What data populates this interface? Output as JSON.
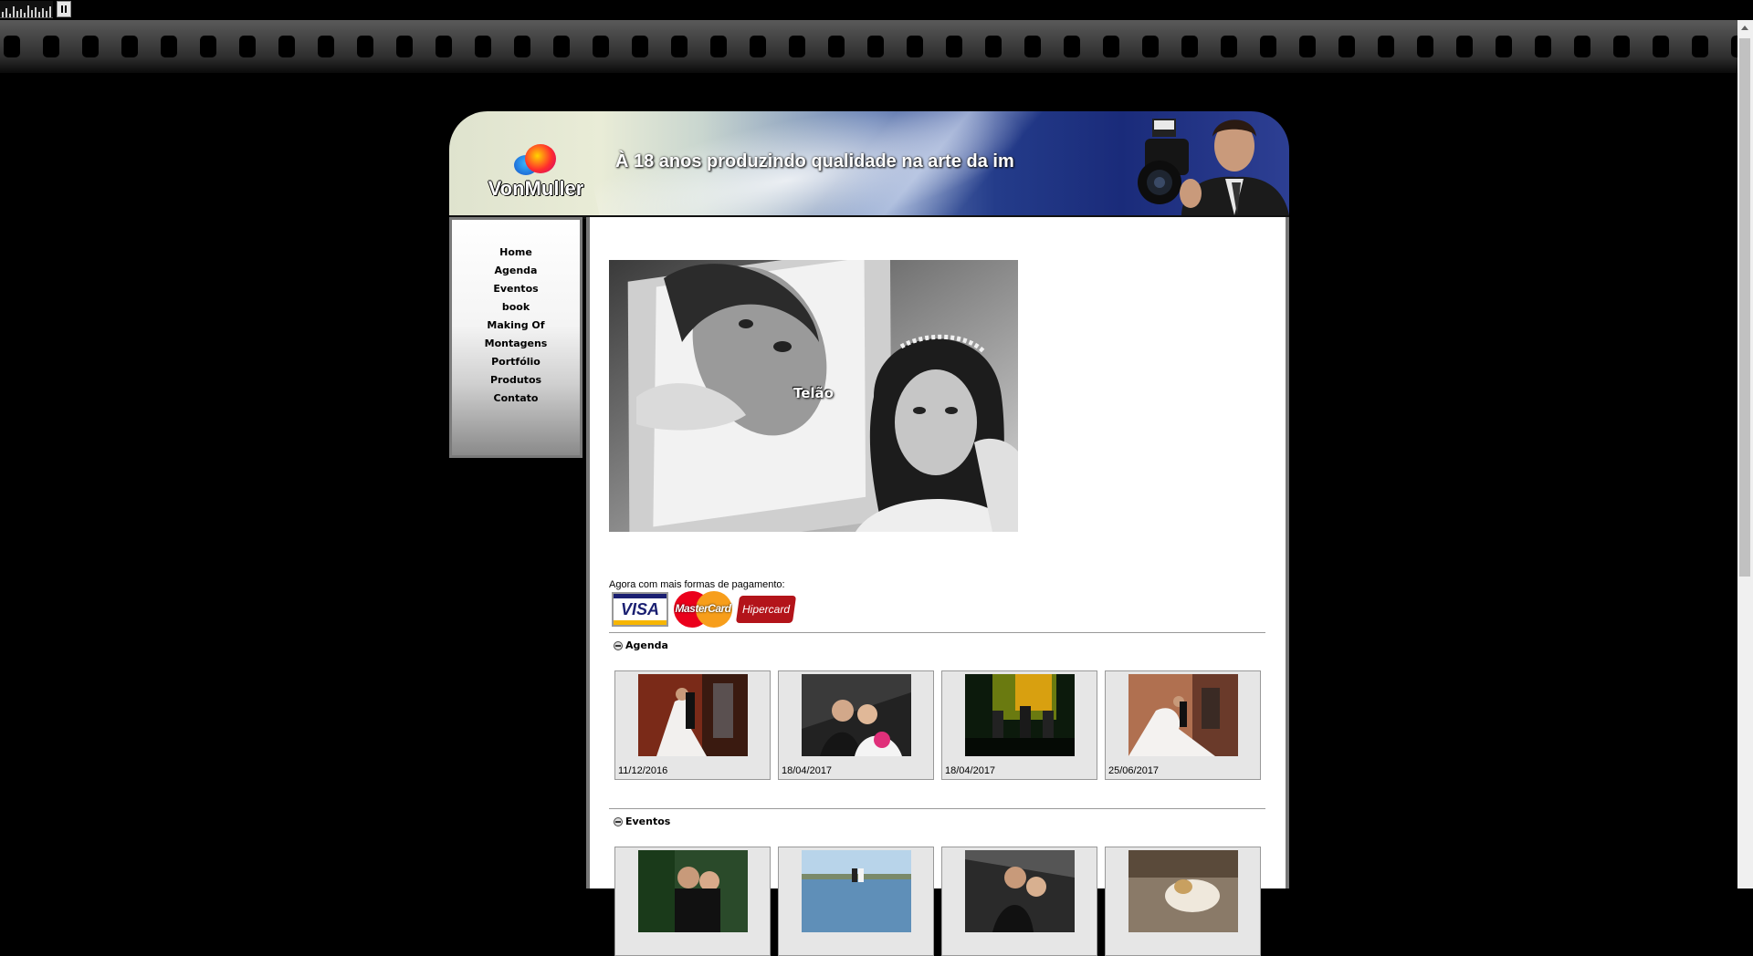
{
  "player": {
    "pause_icon": "pause-icon"
  },
  "colors": {
    "background": "#000000",
    "content_bg": "#ffffff",
    "nav_border": "#7a7a7a",
    "visa_blue": "#1a1f71",
    "hipercard_red": "#b3141a"
  },
  "header": {
    "logo_text": "VonMuller",
    "tagline": "À 18 anos produzindo qualidade na arte da im"
  },
  "nav": {
    "items": [
      "Home",
      "Agenda",
      "Eventos",
      "book",
      "Making Of",
      "Montagens",
      "Portfólio",
      "Produtos",
      "Contato"
    ]
  },
  "slideshow": {
    "caption": "Telão"
  },
  "payment": {
    "text": "Agora com mais formas de pagamento:",
    "cards": [
      "VISA",
      "MasterCard",
      "Hipercard"
    ]
  },
  "sections": [
    {
      "title": "Agenda",
      "items": [
        {
          "date": "11/12/2016"
        },
        {
          "date": "18/04/2017"
        },
        {
          "date": "18/04/2017"
        },
        {
          "date": "25/06/2017"
        }
      ]
    },
    {
      "title": "Eventos",
      "items": [
        {},
        {},
        {},
        {}
      ]
    }
  ]
}
